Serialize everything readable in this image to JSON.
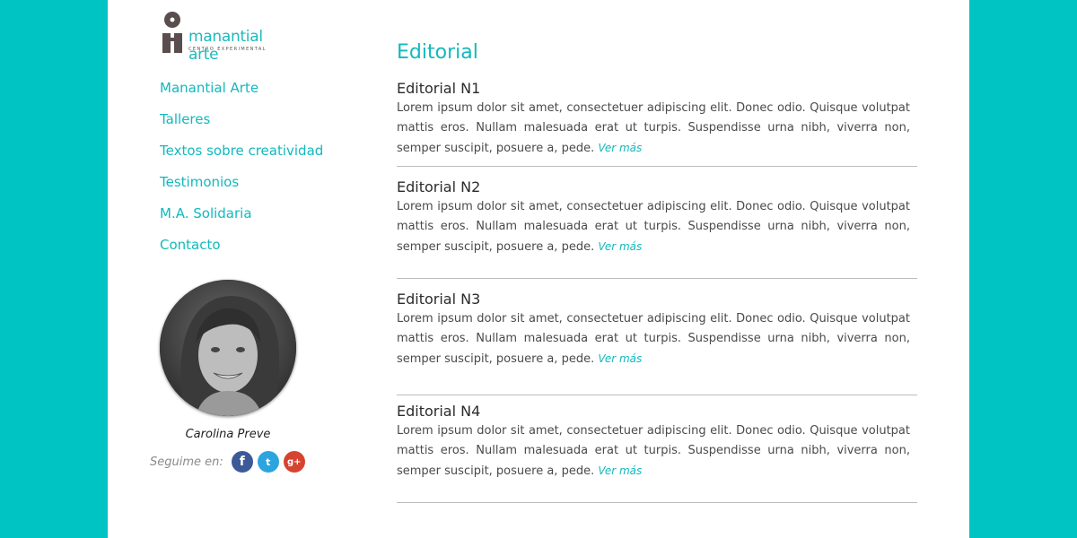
{
  "logo": {
    "name": "manantial arte",
    "subtitle": "CENTRO EXPERIMENTAL",
    "icon": "manantial-logo-icon"
  },
  "nav": {
    "items": [
      {
        "label": "Manantial Arte"
      },
      {
        "label": "Talleres"
      },
      {
        "label": "Textos sobre creatividad"
      },
      {
        "label": "Testimonios"
      },
      {
        "label": "M.A. Solidaria"
      },
      {
        "label": "Contacto"
      }
    ]
  },
  "profile": {
    "name": "Carolina Preve",
    "follow_label": "Seguime en:",
    "social": [
      {
        "name": "facebook-icon",
        "glyph": "f",
        "color": "#3c5a98"
      },
      {
        "name": "twitter-icon",
        "glyph": "t",
        "color": "#2ba4e0"
      },
      {
        "name": "google-plus-icon",
        "glyph": "g+",
        "color": "#d64330"
      }
    ]
  },
  "main": {
    "title": "Editorial",
    "articles": [
      {
        "title": "Editorial N1",
        "text": "Lorem ipsum dolor sit amet, consectetuer adipiscing elit. Donec odio. Quisque volutpat mattis eros. Nullam malesuada erat ut turpis. Suspendisse urna nibh, viverra non, semper suscipit, posuere a, pede.",
        "more": "Ver más"
      },
      {
        "title": "Editorial N2",
        "text": "Lorem ipsum dolor sit amet, consectetuer adipiscing elit. Donec odio. Quisque volutpat mattis eros. Nullam malesuada erat ut turpis. Suspendisse urna nibh, viverra non, semper suscipit, posuere a, pede.",
        "more": "Ver más"
      },
      {
        "title": "Editorial N3",
        "text": "Lorem ipsum dolor sit amet, consectetuer adipiscing elit. Donec odio. Quisque volutpat mattis eros. Nullam malesuada erat ut turpis. Suspendisse urna nibh, viverra non, semper suscipit, posuere a, pede.",
        "more": "Ver más"
      },
      {
        "title": "Editorial N4",
        "text": "Lorem ipsum dolor sit amet, consectetuer adipiscing elit. Donec odio. Quisque volutpat mattis eros. Nullam malesuada erat ut turpis. Suspendisse urna nibh, viverra non, semper suscipit, posuere a, pede.",
        "more": "Ver más"
      }
    ]
  },
  "colors": {
    "background": "#00c4c4",
    "accent": "#12b9bd",
    "panel": "#ffffff"
  }
}
